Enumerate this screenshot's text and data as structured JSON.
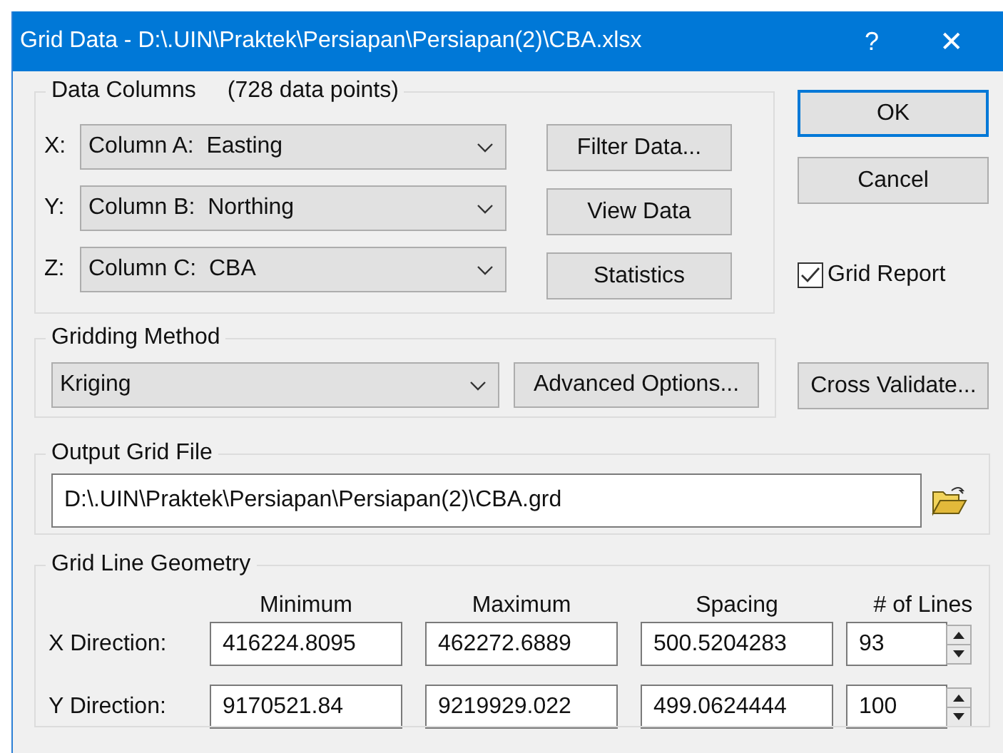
{
  "window": {
    "title": "Grid Data - D:\\.UIN\\Praktek\\Persiapan\\Persiapan(2)\\CBA.xlsx",
    "help": "?",
    "close": "✕"
  },
  "data_columns": {
    "title": "Data Columns",
    "count": "(728 data points)",
    "rows": [
      {
        "label": "X:",
        "value": "Column A:  Easting"
      },
      {
        "label": "Y:",
        "value": "Column B:  Northing"
      },
      {
        "label": "Z:",
        "value": "Column C:  CBA"
      }
    ],
    "buttons": [
      "Filter Data...",
      "View Data",
      "Statistics"
    ]
  },
  "dialog_buttons": [
    {
      "label": "OK",
      "default": true
    },
    {
      "label": "Cancel",
      "default": false
    }
  ],
  "grid_report": {
    "label": "Grid Report",
    "checked": true
  },
  "gridding_method": {
    "title": "Gridding Method",
    "value": "Kriging",
    "button": "Advanced Options..."
  },
  "cross_validate": "Cross Validate...",
  "output_grid_file": {
    "title": "Output Grid File",
    "value": "D:\\.UIN\\Praktek\\Persiapan\\Persiapan(2)\\CBA.grd"
  },
  "grid_line_geometry": {
    "title": "Grid Line Geometry",
    "columns": [
      "Minimum",
      "Maximum",
      "Spacing",
      "# of Lines"
    ],
    "rows": [
      {
        "label": "X Direction:",
        "values": [
          "416224.8095",
          "462272.6889",
          "500.5204283",
          "93"
        ]
      },
      {
        "label": "Y Direction:",
        "values": [
          "9170521.84",
          "9219929.022",
          "499.0624444",
          "100"
        ]
      }
    ]
  }
}
